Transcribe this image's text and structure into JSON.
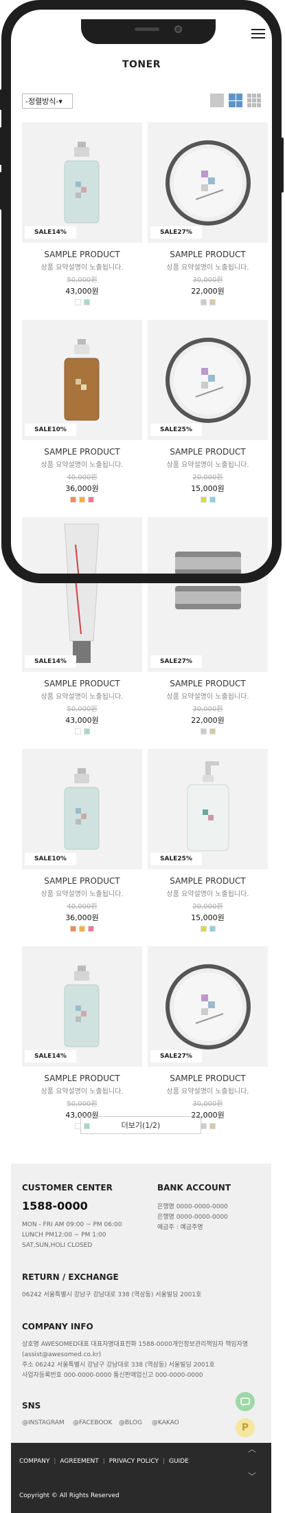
{
  "header": {
    "title": "TONER",
    "menu_icon": "hamburger-icon"
  },
  "toolbar": {
    "sort_label": "-정렬방식-▾",
    "view_icons": [
      "view-list-icon",
      "view-2col-icon",
      "view-3col-icon"
    ]
  },
  "products": [
    {
      "sale": "SALE14%",
      "name": "SAMPLE PRODUCT",
      "desc": "상품 요약설명이 노출됩니다.",
      "orig": "50,000원",
      "price": "43,000원",
      "colors": [
        "#ffffff",
        "#a8d8c8"
      ],
      "kind": "spray"
    },
    {
      "sale": "SALE27%",
      "name": "SAMPLE PRODUCT",
      "desc": "상품 요약설명이 노출됩니다.",
      "orig": "30,000원",
      "price": "22,000원",
      "colors": [
        "#cccccc",
        "#d8c8a8"
      ],
      "kind": "jar"
    },
    {
      "sale": "SALE10%",
      "name": "SAMPLE PRODUCT",
      "desc": "상품 요약설명이 노출됩니다.",
      "orig": "40,000원",
      "price": "36,000원",
      "colors": [
        "#f08a5a",
        "#f0b040",
        "#f07890"
      ],
      "kind": "amber"
    },
    {
      "sale": "SALE25%",
      "name": "SAMPLE PRODUCT",
      "desc": "상품 요약설명이 노출됩니다.",
      "orig": "20,000원",
      "price": "15,000원",
      "colors": [
        "#d8d850",
        "#90d0e0"
      ],
      "kind": "jar"
    },
    {
      "sale": "SALE14%",
      "name": "SAMPLE PRODUCT",
      "desc": "상품 요약설명이 노출됩니다.",
      "orig": "50,000원",
      "price": "43,000원",
      "colors": [
        "#ffffff",
        "#a8d8c8"
      ],
      "kind": "tube"
    },
    {
      "sale": "SALE27%",
      "name": "SAMPLE PRODUCT",
      "desc": "상품 요약설명이 노출됩니다.",
      "orig": "30,000원",
      "price": "22,000원",
      "colors": [
        "#cccccc",
        "#d8c8a8"
      ],
      "kind": "tin"
    },
    {
      "sale": "SALE10%",
      "name": "SAMPLE PRODUCT",
      "desc": "상품 요약설명이 노출됩니다.",
      "orig": "40,000원",
      "price": "36,000원",
      "colors": [
        "#f08a5a",
        "#f0b040",
        "#f07890"
      ],
      "kind": "spray"
    },
    {
      "sale": "SALE25%",
      "name": "SAMPLE PRODUCT",
      "desc": "상품 요약설명이 노출됩니다.",
      "orig": "20,000원",
      "price": "15,000원",
      "colors": [
        "#d8d850",
        "#90d0e0"
      ],
      "kind": "pump"
    },
    {
      "sale": "SALE14%",
      "name": "SAMPLE PRODUCT",
      "desc": "상품 요약설명이 노출됩니다.",
      "orig": "50,000원",
      "price": "43,000원",
      "colors": [
        "#ffffff",
        "#a8d8c8"
      ],
      "kind": "spray"
    },
    {
      "sale": "SALE27%",
      "name": "SAMPLE PRODUCT",
      "desc": "상품 요약설명이 노출됩니다.",
      "orig": "30,000원",
      "price": "22,000원",
      "colors": [
        "#cccccc",
        "#d8c8a8"
      ],
      "kind": "jar"
    }
  ],
  "more_button": "더보기(1/2)",
  "footer": {
    "customer_center": {
      "heading": "CUSTOMER CENTER",
      "phone": "1588-0000",
      "hours": [
        "MON - FRI AM 09:00 ~ PM 06:00",
        "LUNCH PM12:00 ~ PM 1:00",
        "SAT,SUN,HOLI CLOSED"
      ]
    },
    "bank_account": {
      "heading": "BANK ACCOUNT",
      "lines": [
        "은행명 0000-0000-0000",
        "은행명 0000-0000-0000",
        "예금주 : 예금주명"
      ]
    },
    "return": {
      "heading": "RETURN / EXCHANGE",
      "address": "06242 서울특별시 강남구 강남대로 338 (역삼동) 서울빌딩 2001호"
    },
    "company": {
      "heading": "COMPANY INFO",
      "lines": [
        "상호명 AWESOMED대표 대표자명대표전화 1588-0000개인정보관리책임자 책임자명",
        "(assist@awesomed.co.kr)",
        "주소 06242 서울특별시 강남구 강남대로 338 (역삼동) 서울빌딩 2001호",
        "사업자등록번호 000-0000-0000 통신판매업신고 000-0000-0000"
      ]
    },
    "sns": {
      "heading": "SNS",
      "links": [
        "@INSTAGRAM",
        "@FACEBOOK",
        "@BLOG",
        "@KAKAO"
      ]
    }
  },
  "bottom_bar": {
    "links": [
      "COMPANY",
      "AGREEMENT",
      "PRIVACY POLICY",
      "GUIDE"
    ],
    "copyright": "Copyright © All Rights Reserved"
  },
  "floating": {
    "chat_color": "#9ed8a8",
    "p_color": "#f5e6a0",
    "p_label": "P"
  }
}
